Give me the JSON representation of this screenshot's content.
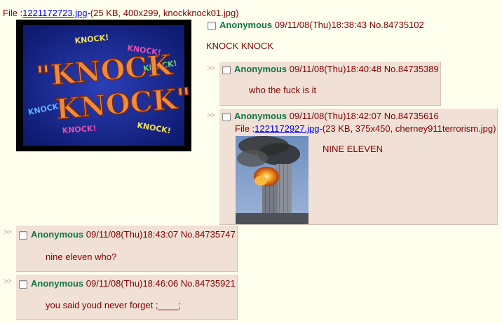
{
  "op": {
    "file_prefix": "File :",
    "file_link": "1221172723.jpg",
    "file_details": "-(25 KB, 400x299, knockknock01.jpg)",
    "image": {
      "words": [
        "KNOCK!",
        "KNOCK!",
        "KNOCK!",
        "KNOCK!",
        "KNOCK!",
        "KNOCK!"
      ],
      "big_line1": "\"KNOCK",
      "big_line2": "KNOCK\""
    },
    "name": "Anonymous",
    "datetime": "09/11/08(Thu)18:38:43",
    "post_no": "No.84735102",
    "comment": "KNOCK KNOCK"
  },
  "replies": [
    {
      "arrows": ">>",
      "name": "Anonymous",
      "datetime": "09/11/08(Thu)18:40:48",
      "post_no": "No.84735389",
      "comment": "who the fuck is it"
    },
    {
      "arrows": ">>",
      "name": "Anonymous",
      "datetime": "09/11/08(Thu)18:42:07",
      "post_no": "No.84735616",
      "file_prefix": "File :",
      "file_link": "1221172927.jpg",
      "file_details": "-(23 KB, 375x450, cherney911terrorism.jpg)",
      "comment": "NINE ELEVEN"
    },
    {
      "arrows": ">>",
      "name": "Anonymous",
      "datetime": "09/11/08(Thu)18:43:07",
      "post_no": "No.84735747",
      "comment": "nine eleven who?"
    },
    {
      "arrows": ">>",
      "name": "Anonymous",
      "datetime": "09/11/08(Thu)18:46:06",
      "post_no": "No.84735921",
      "comment": "you said youd never forget ;____;"
    }
  ],
  "colors": {
    "page_bg": "#ffffee",
    "reply_bg": "#f0e0d6",
    "name": "#117743",
    "text": "#800000",
    "link": "#0000ee"
  }
}
